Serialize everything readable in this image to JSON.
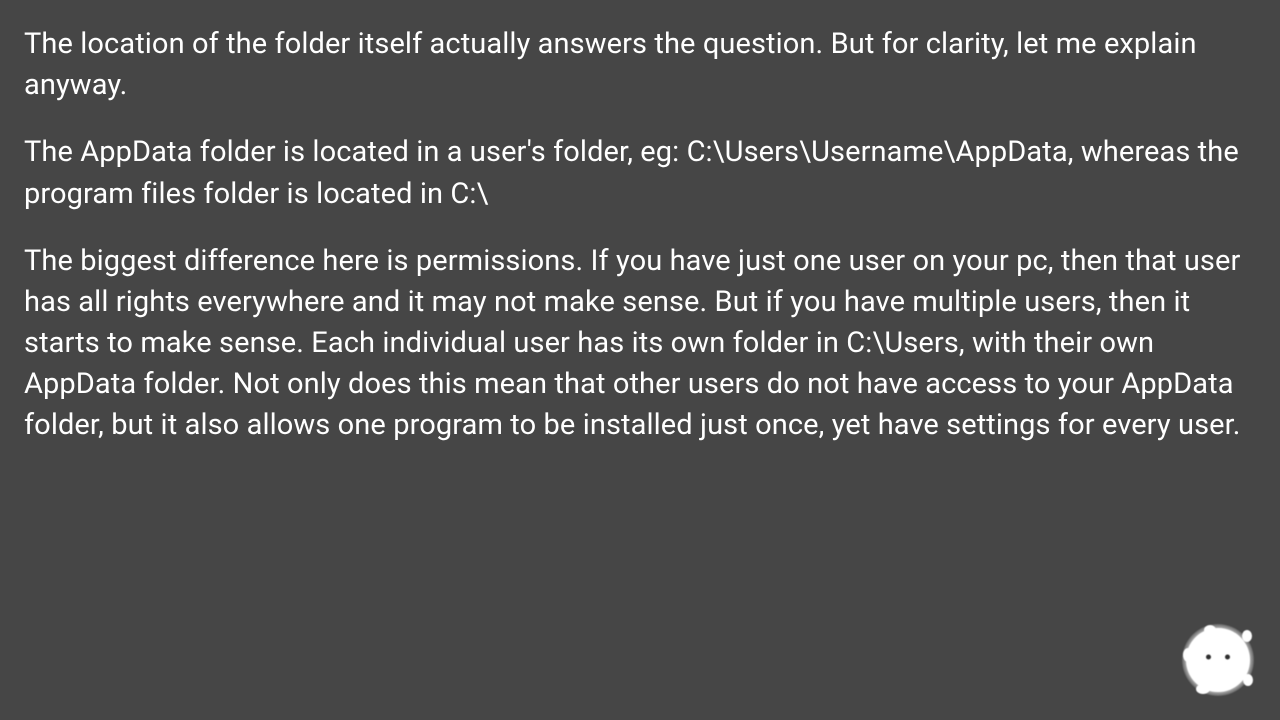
{
  "paragraphs": [
    "The location of the folder itself actually answers the question. But for clarity, let me explain anyway.",
    "The AppData folder is located in a user's folder, eg: C:\\Users\\Username\\AppData, whereas the program files folder is located in C:\\",
    "The biggest difference here is permissions. If you have just one user on your pc, then that user has all rights everywhere and it may not make sense. But if you have multiple users, then it starts to make sense. Each individual user has its own folder in C:\\Users, with their own AppData folder. Not only does this mean that other users do not have access to your AppData folder, but it also allows one program to be installed just once, yet have settings for every user."
  ]
}
